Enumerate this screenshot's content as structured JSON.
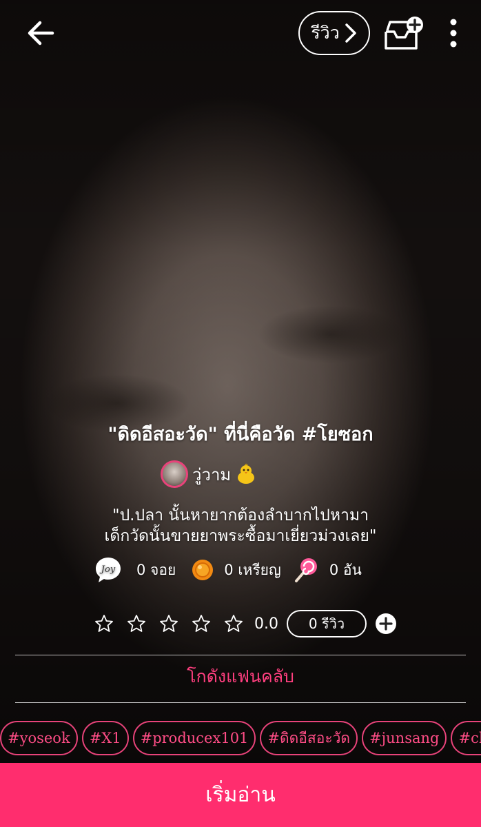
{
  "header": {
    "back_icon": "arrow-left-icon",
    "review_label": "รีวิว",
    "review_chevron_icon": "chevron-right-icon",
    "library_icon": "add-to-library-icon",
    "more_icon": "more-vertical-icon"
  },
  "story": {
    "title": "\"ดิดอีสอะวัด\" ที่นี่คือวัด #โยซอก",
    "author": "วู่วาม",
    "author_badge_icon": "chick-icon",
    "description_lines": [
      "\"ป.ปลา นั้นหายากต้องลำบากไปหามา",
      "เด็กวัดนั้นขายยาพระซื้อมาเยี่ยวม่วงเลย\""
    ]
  },
  "stats": {
    "joy": {
      "icon": "joy-icon",
      "label": "0 จอย"
    },
    "coin": {
      "icon": "coin-icon",
      "label": "0 เหรียญ"
    },
    "candy": {
      "icon": "lollipop-icon",
      "label": "0 อัน"
    }
  },
  "rating": {
    "stars_filled": 0,
    "stars_total": 5,
    "value": "0.0",
    "reviews_label": "0 รีวิว",
    "add_icon": "plus-circle-icon"
  },
  "fanclub_label": "โกดังแฟนคลับ",
  "tags": [
    "#yoseok",
    "#X1",
    "#producex101",
    "#ดิดอีสอะวัด",
    "#junsang",
    "#chohan"
  ],
  "start_button_label": "เริ่มอ่าน",
  "colors": {
    "accent": "#ff2d6e",
    "tag_border": "#e8437a",
    "text": "#ffffff"
  }
}
